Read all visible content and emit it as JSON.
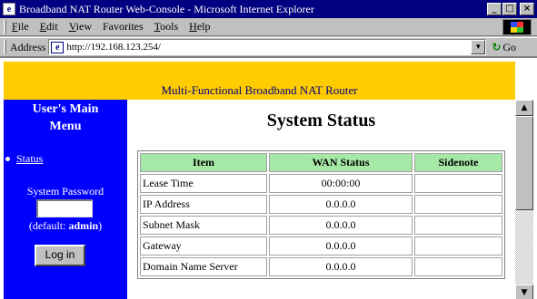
{
  "window": {
    "title": "Broadband NAT Router Web-Console - Microsoft Internet Explorer",
    "app_icon": "e",
    "min_glyph": "_",
    "max_glyph": "□",
    "close_glyph": "×"
  },
  "menubar": {
    "items": [
      {
        "hotkey": "F",
        "rest": "ile"
      },
      {
        "hotkey": "E",
        "rest": "dit"
      },
      {
        "hotkey": "V",
        "rest": "iew"
      },
      {
        "hotkey": "",
        "rest": "Favorites"
      },
      {
        "hotkey": "T",
        "rest": "ools"
      },
      {
        "hotkey": "H",
        "rest": "elp"
      }
    ]
  },
  "addressbar": {
    "label": "Address",
    "value": "http://192.168.123.254/",
    "go_label": "Go",
    "page_icon": "e",
    "go_arrow": "↻",
    "dropdown_glyph": "▼"
  },
  "banner": {
    "text": "Multi-Functional Broadband NAT Router"
  },
  "sidebar": {
    "menu_title_line1": "User's Main",
    "menu_title_line2": "Menu",
    "status_link": "Status",
    "password_label": "System Password",
    "hint_prefix": "(default: ",
    "hint_value": "admin",
    "hint_suffix": ")",
    "login_button": "Log in"
  },
  "main": {
    "title": "System Status",
    "table": {
      "headers": [
        "Item",
        "WAN Status",
        "Sidenote"
      ],
      "rows": [
        {
          "item": "Lease Time",
          "value": "00:00:00",
          "note": ""
        },
        {
          "item": "IP Address",
          "value": "0.0.0.0",
          "note": ""
        },
        {
          "item": "Subnet Mask",
          "value": "0.0.0.0",
          "note": ""
        },
        {
          "item": "Gateway",
          "value": "0.0.0.0",
          "note": ""
        },
        {
          "item": "Domain Name Server",
          "value": "0.0.0.0",
          "note": ""
        }
      ]
    }
  },
  "scrollbar": {
    "up_glyph": "▲",
    "down_glyph": "▼"
  }
}
